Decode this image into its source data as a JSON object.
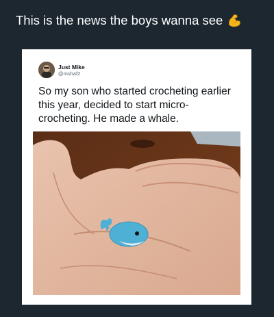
{
  "caption": {
    "text": "This is the news the boys wanna see",
    "emoji": "flexed-biceps-icon"
  },
  "tweet": {
    "display_name": "Just Mike",
    "handle": "@mshaf2",
    "lines": [
      "So my son who started crocheting earlier",
      "this year, decided to start micro-",
      "crocheting.  He made a whale."
    ]
  },
  "photo": {
    "subject": "tiny blue crocheted whale on a hand"
  },
  "colors": {
    "background": "#1d2730",
    "card": "#ffffff",
    "whale": "#4fb0d6"
  }
}
